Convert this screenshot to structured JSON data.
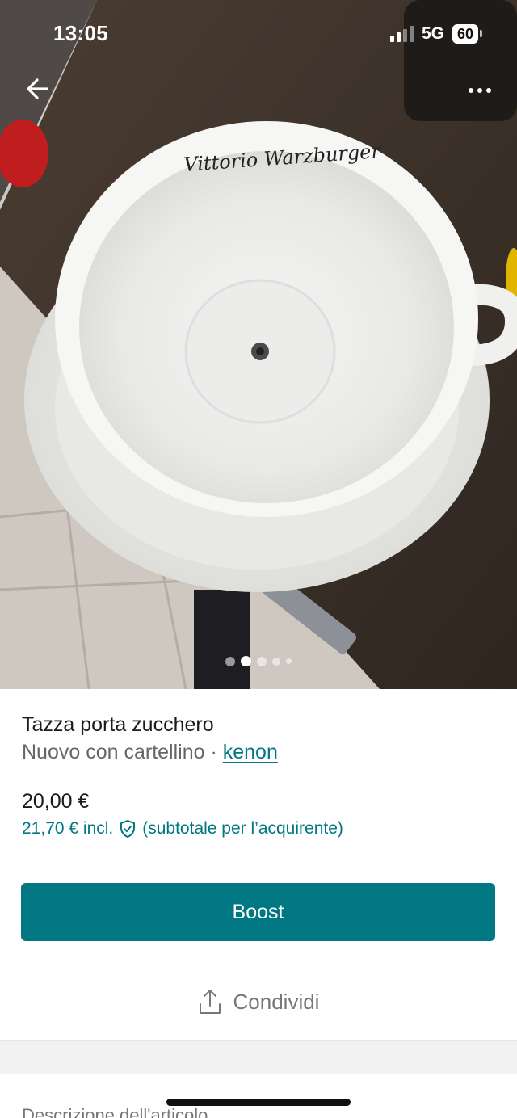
{
  "status_bar": {
    "time": "13:05",
    "network": "5G",
    "battery": "60"
  },
  "navigation": {
    "back_icon": "arrow-left-icon",
    "more_icon": "more-dots-icon"
  },
  "gallery": {
    "image_count": 5,
    "active_index": 1,
    "signature_text": "Vittorio Warzburger"
  },
  "item": {
    "title": "Tazza porta zucchero",
    "condition": "Nuovo con cartellino",
    "separator": " · ",
    "brand": "kenon",
    "price": "20,00 €",
    "price_incl": "21,70 € incl.",
    "price_incl_note": "(subtotale per l’acquirente)"
  },
  "actions": {
    "boost_label": "Boost",
    "share_label": "Condividi"
  },
  "section": {
    "description_label": "Descrizione dell'articolo"
  },
  "colors": {
    "accent": "#007782",
    "text": "#1a1a1a",
    "muted": "#666666"
  }
}
